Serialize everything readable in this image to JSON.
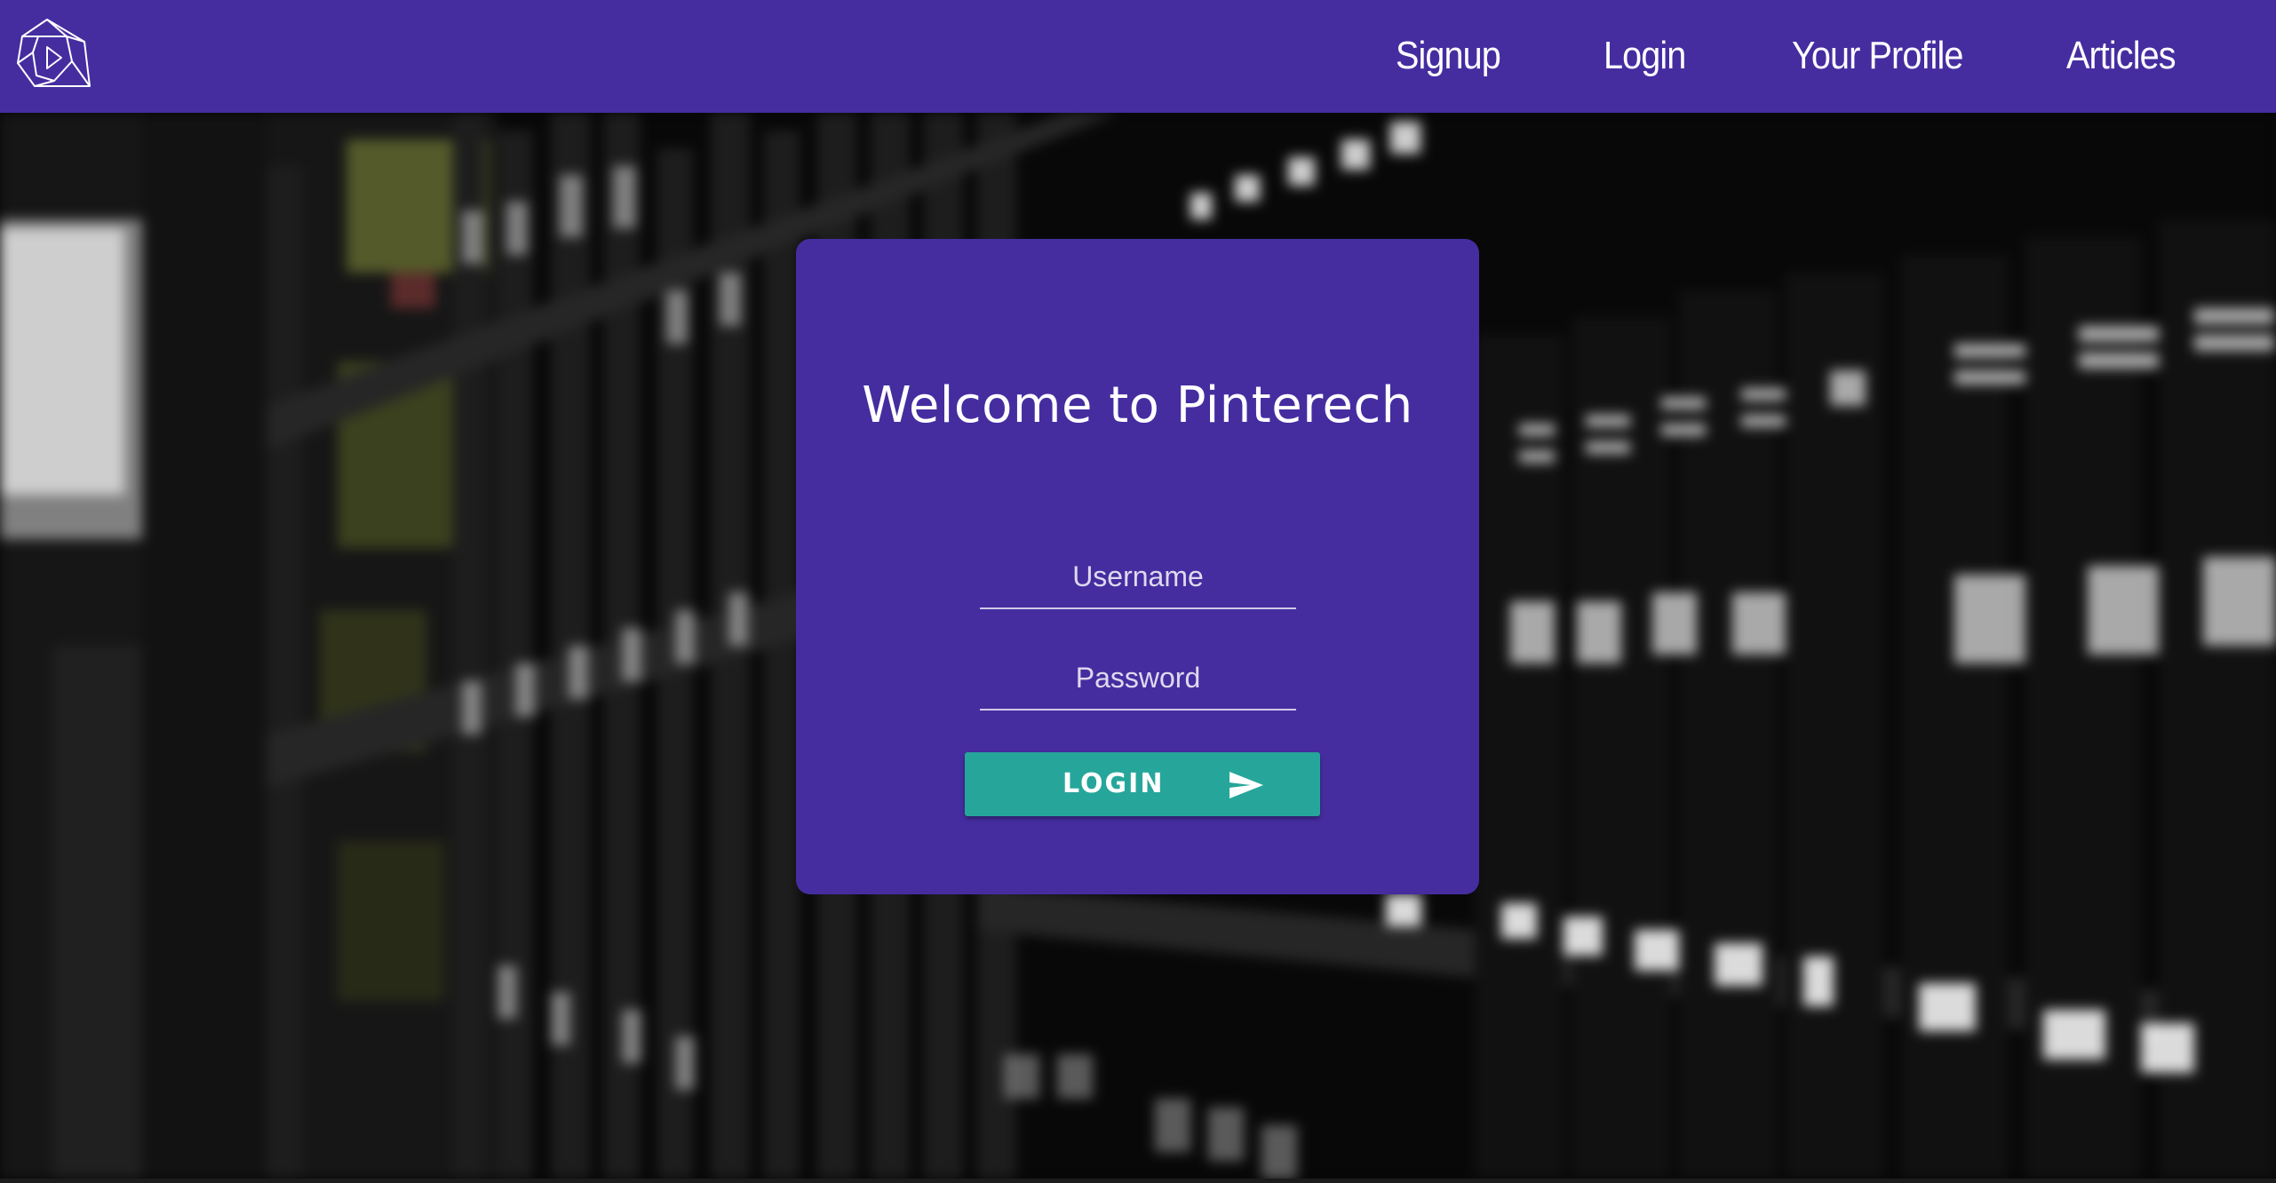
{
  "navbar": {
    "logo_icon": "play-logo-icon",
    "links": [
      {
        "label": "Signup"
      },
      {
        "label": "Login"
      },
      {
        "label": "Your Profile"
      },
      {
        "label": "Articles"
      }
    ],
    "background_color": "#452da0"
  },
  "background": {
    "image": "blurred-library-bookshelves"
  },
  "login_card": {
    "title": "Welcome to Pinterech",
    "username_placeholder": "Username",
    "password_placeholder": "Password",
    "login_button_label": "LOGIN",
    "login_button_icon": "send-icon",
    "card_color": "#452da0",
    "button_color": "#26a69a"
  }
}
